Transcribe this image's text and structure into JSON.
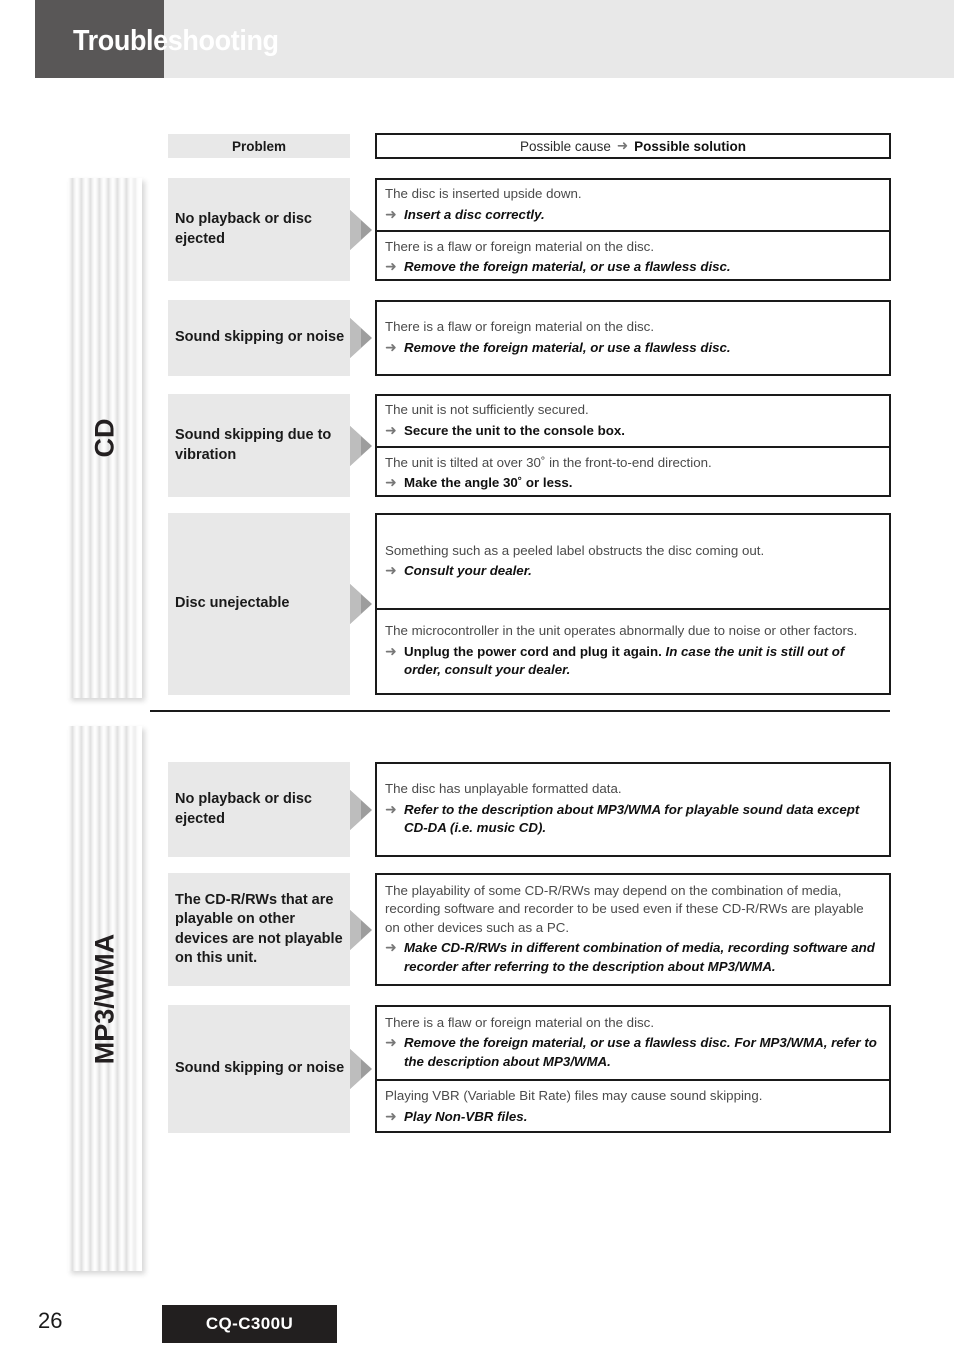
{
  "header": {
    "title": "Troubleshooting"
  },
  "table_headers": {
    "problem": "Problem",
    "cause_prefix": "Possible cause",
    "cause_arrow": "➜",
    "cause_solution": "Possible solution"
  },
  "arrow_glyph": "➜",
  "sections": [
    {
      "ribbon_label": "CD",
      "rows": [
        {
          "problem": "No playback or disc ejected",
          "cells": [
            {
              "cause": "The disc is inserted upside down.",
              "solution_bold": "",
              "solution_italic": "Insert a disc correctly."
            },
            {
              "cause": "There is a flaw or foreign material on the disc.",
              "solution_bold": "",
              "solution_italic": "Remove the foreign material, or use a flawless disc."
            }
          ]
        },
        {
          "problem": "Sound skipping or noise",
          "cells": [
            {
              "cause": "There is a flaw or foreign material on the disc.",
              "solution_bold": "",
              "solution_italic": "Remove the foreign material, or use a flawless disc."
            }
          ]
        },
        {
          "problem": "Sound skipping due to vibration",
          "cells": [
            {
              "cause": "The unit is not sufficiently secured.",
              "solution_bold": "Secure the unit to the console box.",
              "solution_italic": ""
            },
            {
              "cause": "The unit is tilted at over 30˚ in the front-to-end direction.",
              "solution_bold": "Make the angle 30˚ or less.",
              "solution_italic": ""
            }
          ]
        },
        {
          "problem": "Disc unejectable",
          "cells": [
            {
              "cause": "Something such as a peeled label obstructs the disc coming out.",
              "solution_bold": "",
              "solution_italic": "Consult your dealer."
            },
            {
              "cause": "The microcontroller in the unit operates abnormally due to noise or other factors.",
              "solution_bold": "Unplug the power cord and plug it again.",
              "solution_italic": "In case the unit is still out of order, consult your dealer."
            }
          ]
        }
      ]
    },
    {
      "ribbon_label": "MP3/WMA",
      "rows": [
        {
          "problem": "No playback or disc ejected",
          "cells": [
            {
              "cause": "The disc has unplayable formatted data.",
              "solution_bold": "",
              "solution_italic": "Refer to the description about MP3/WMA for playable sound data except CD-DA (i.e. music CD)."
            }
          ]
        },
        {
          "problem": "The CD-R/RWs that are playable on other devices are not playable on this unit.",
          "cells": [
            {
              "cause": "The playability of some CD-R/RWs may depend on the combination of media, recording software and recorder to be used even if these CD-R/RWs are playable on other devices such as a PC.",
              "solution_bold": "",
              "solution_italic": "Make CD-R/RWs in different combination of media, recording software and recorder after referring to the description about MP3/WMA."
            }
          ]
        },
        {
          "problem": "Sound skipping or noise",
          "cells": [
            {
              "cause": "There is a flaw or foreign material on the disc.",
              "solution_bold": "",
              "solution_italic": "Remove the foreign material, or use a flawless disc. For MP3/WMA, refer to the description about MP3/WMA."
            },
            {
              "cause": "Playing VBR (Variable Bit Rate) files may cause sound skipping.",
              "solution_bold": "",
              "solution_italic": "Play Non-VBR files."
            }
          ]
        }
      ]
    }
  ],
  "footer": {
    "page_number": "26",
    "model": "CQ-C300U"
  },
  "colors": {
    "title_box": "#595757",
    "header_band": "#e8e8e8",
    "problem_cell": "#e8e8e8",
    "border": "#1a1a1a",
    "model_box": "#221f1f",
    "arrow": "#777777"
  }
}
